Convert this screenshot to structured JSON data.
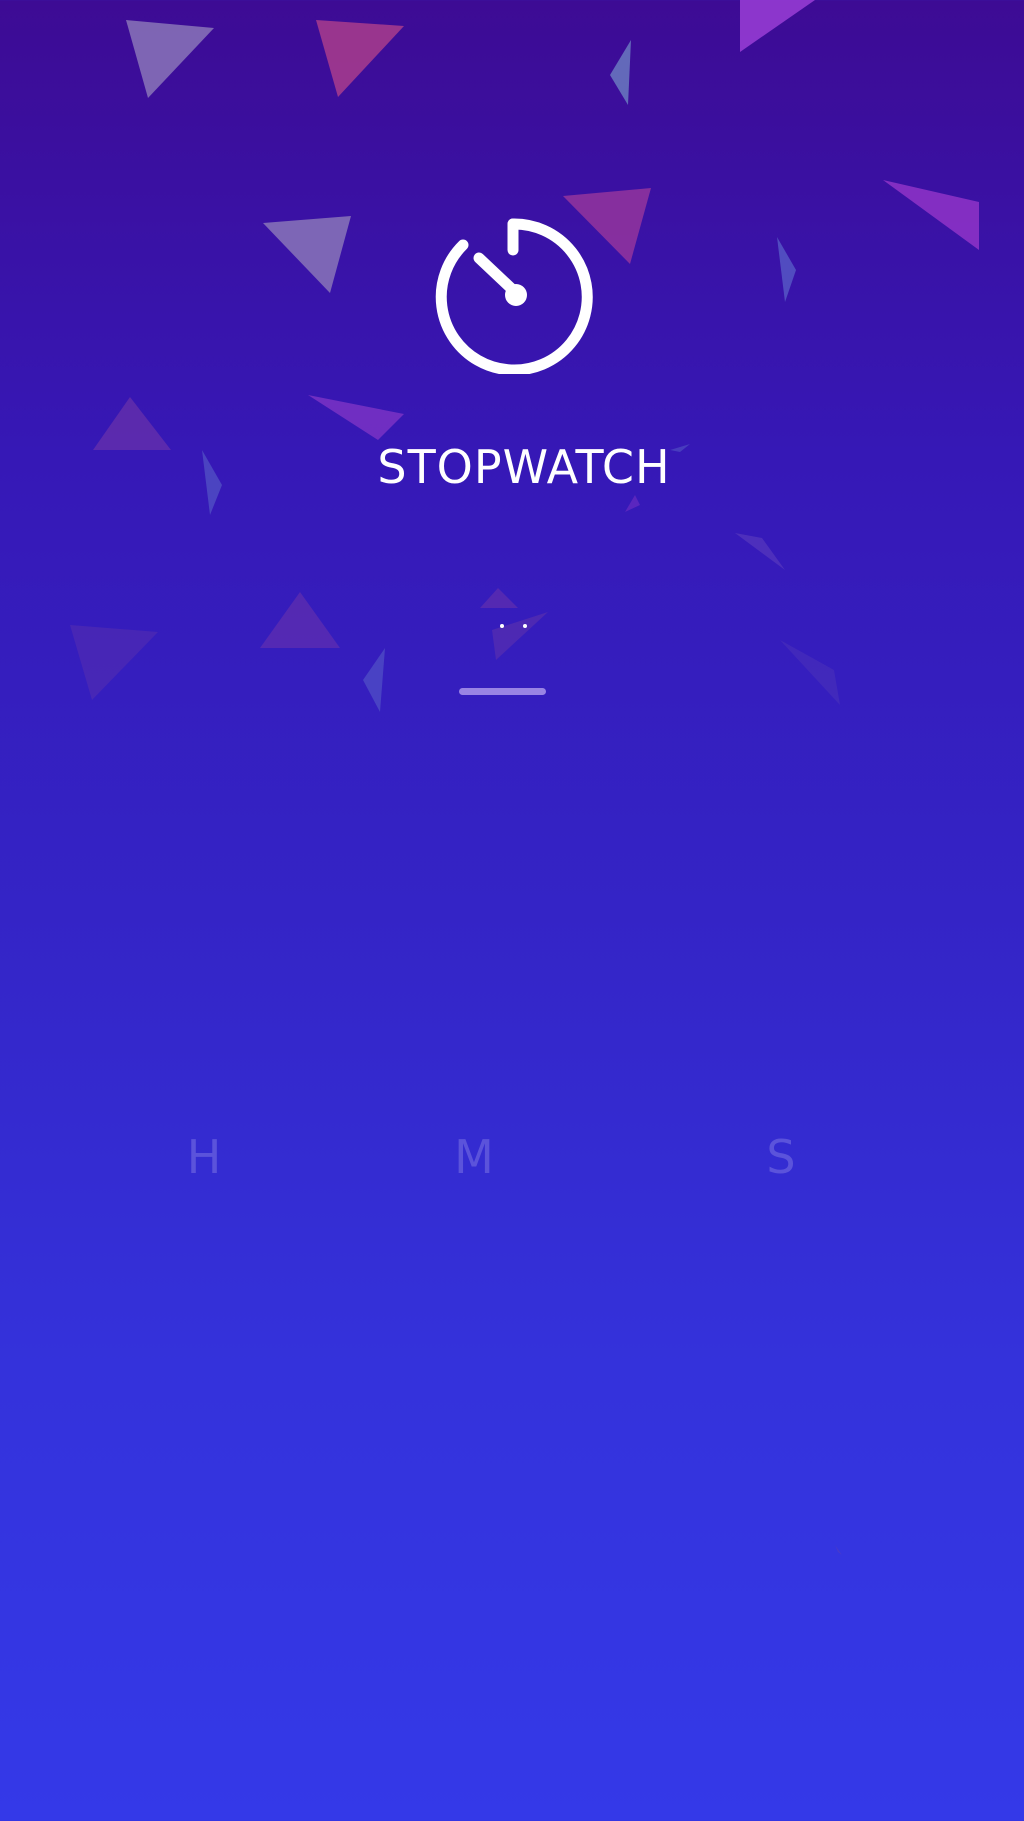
{
  "app": {
    "title": "STOPWATCH"
  },
  "icons": {
    "main": "stopwatch-icon"
  },
  "loading": {
    "state": "loading",
    "dots_visible": 2
  },
  "time_units": {
    "hours_label": "H",
    "minutes_label": "M",
    "seconds_label": "S"
  },
  "colors": {
    "background_top": "#3d0b94",
    "background_bottom": "#3439e8",
    "title_color": "#ffffff",
    "unit_label_color": "#5b53db",
    "confetti_pink": "#b0408c",
    "confetti_purple": "#8a3ad0",
    "confetti_gray": "#8a75b8",
    "confetti_blue": "#5a60c8"
  }
}
